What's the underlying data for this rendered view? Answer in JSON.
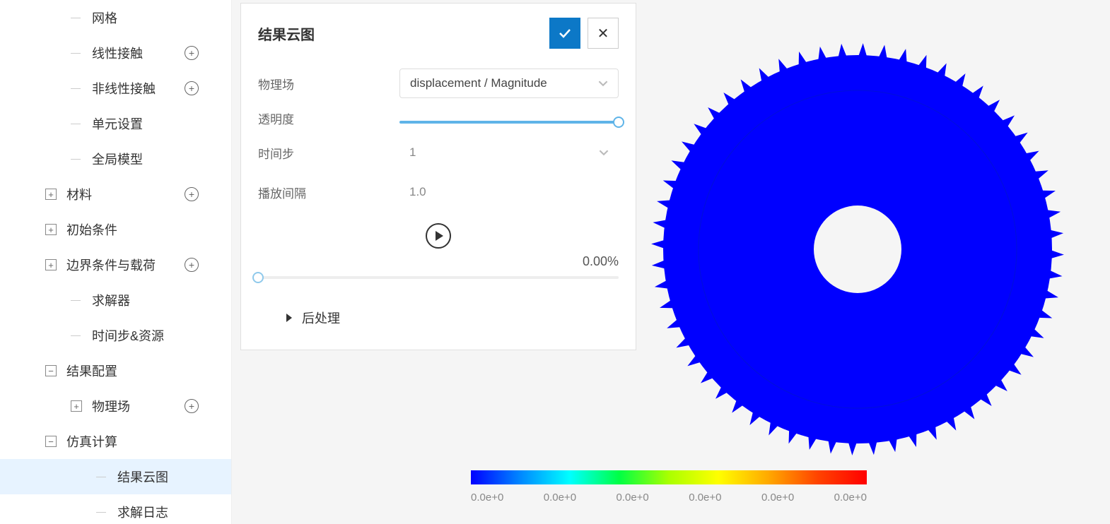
{
  "sidebar": {
    "items": [
      {
        "label": "网格",
        "indent": 2,
        "plus": false,
        "expand": null
      },
      {
        "label": "线性接触",
        "indent": 2,
        "plus": true,
        "expand": null
      },
      {
        "label": "非线性接触",
        "indent": 2,
        "plus": true,
        "expand": null
      },
      {
        "label": "单元设置",
        "indent": 2,
        "plus": false,
        "expand": null
      },
      {
        "label": "全局模型",
        "indent": 2,
        "plus": false,
        "expand": null
      },
      {
        "label": "材料",
        "indent": 1,
        "plus": true,
        "expand": "+"
      },
      {
        "label": "初始条件",
        "indent": 1,
        "plus": false,
        "expand": "+"
      },
      {
        "label": "边界条件与载荷",
        "indent": 1,
        "plus": true,
        "expand": "+"
      },
      {
        "label": "求解器",
        "indent": 2,
        "plus": false,
        "expand": null
      },
      {
        "label": "时间步&资源",
        "indent": 2,
        "plus": false,
        "expand": null
      },
      {
        "label": "结果配置",
        "indent": 1,
        "plus": false,
        "expand": "−"
      },
      {
        "label": "物理场",
        "indent": 2,
        "plus": true,
        "expand": "+"
      },
      {
        "label": "仿真计算",
        "indent": 1,
        "plus": false,
        "expand": "−"
      },
      {
        "label": "结果云图",
        "indent": 3,
        "plus": false,
        "expand": null,
        "selected": true
      },
      {
        "label": "求解日志",
        "indent": 3,
        "plus": false,
        "expand": null
      }
    ]
  },
  "panel": {
    "title": "结果云图",
    "physics_label": "物理场",
    "physics_value": "displacement / Magnitude",
    "opacity_label": "透明度",
    "timestep_label": "时间步",
    "timestep_value": "1",
    "interval_label": "播放间隔",
    "interval_value": "1.0",
    "progress_pct": "0.00%",
    "postprocess_label": "后处理"
  },
  "legend": {
    "ticks": [
      "0.0e+0",
      "0.0e+0",
      "0.0e+0",
      "0.0e+0",
      "0.0e+0",
      "0.0e+0"
    ]
  }
}
